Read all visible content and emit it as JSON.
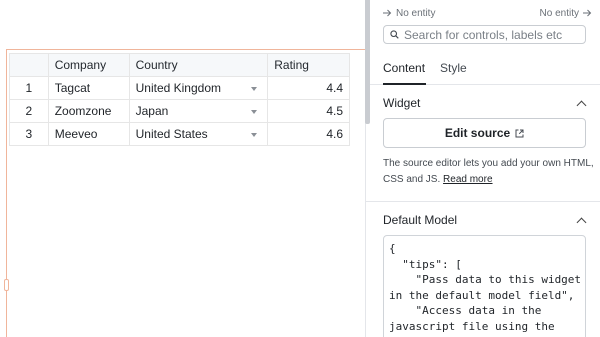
{
  "table": {
    "headers": [
      "",
      "Company",
      "Country",
      "Rating"
    ],
    "rows": [
      {
        "index": "1",
        "company": "Tagcat",
        "country": "United Kingdom",
        "rating": "4.4"
      },
      {
        "index": "2",
        "company": "Zoomzone",
        "country": "Japan",
        "rating": "4.5"
      },
      {
        "index": "3",
        "company": "Meeveo",
        "country": "United States",
        "rating": "4.6"
      }
    ]
  },
  "panel": {
    "entity": {
      "left": "No entity",
      "right": "No entity"
    },
    "search": {
      "placeholder": "Search for controls, labels etc"
    },
    "tabs": [
      {
        "label": "Content",
        "active": true
      },
      {
        "label": "Style",
        "active": false
      }
    ],
    "widget_section": {
      "title": "Widget",
      "edit_source_label": "Edit source",
      "help_text": "The source editor lets you add your own HTML, CSS and JS.",
      "read_more_label": "Read more"
    },
    "default_model_section": {
      "title": "Default Model",
      "code_lines": [
        "{",
        "  \"tips\": [",
        "    \"Pass data to this widget",
        "in the default model field\",",
        "    \"Access data in the",
        "javascript file using the"
      ]
    }
  },
  "colors": {
    "selection": "#f0b59b",
    "header_bg": "#f6f8fa",
    "border": "#e6e6e6"
  }
}
